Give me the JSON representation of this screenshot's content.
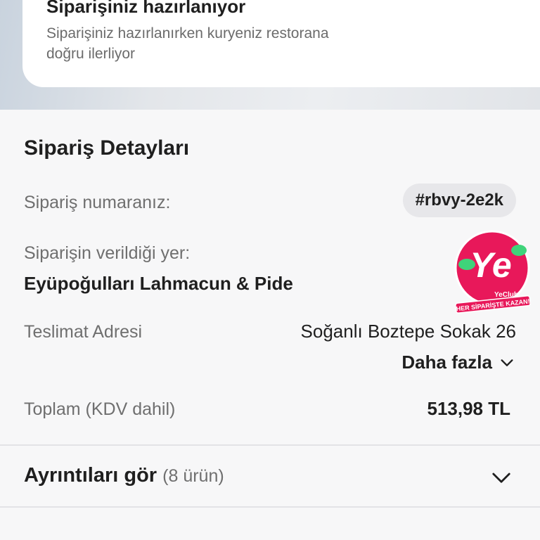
{
  "status": {
    "title": "Siparişiniz hazırlanıyor",
    "description": "Siparişiniz hazırlanırken kuryeniz restorana doğru ilerliyor"
  },
  "order_details": {
    "section_title": "Sipariş Detayları",
    "order_number_label": "Sipariş numaranız:",
    "order_number": "#rbvy-2e2k",
    "place_label": "Siparişin verildiği yer:",
    "place_name": "Eyüpoğulları Lahmacun & Pide",
    "address_label": "Teslimat Adresi",
    "address_value": "Soğanlı Boztepe Sokak 26",
    "more_label": "Daha fazla",
    "total_label": "Toplam (KDV dahil)",
    "total_value": "513,98 TL"
  },
  "details": {
    "title": "Ayrıntıları gör",
    "count": "(8 ürün)"
  },
  "badge": {
    "logo_text": "Ye",
    "brand": "YeClub",
    "slogan": "HER SİPARİŞTE KAZAN!",
    "color": "#e8185a"
  },
  "colors": {
    "status_illustration": "#f6c24f",
    "chip_bg": "#e7e7ea"
  }
}
